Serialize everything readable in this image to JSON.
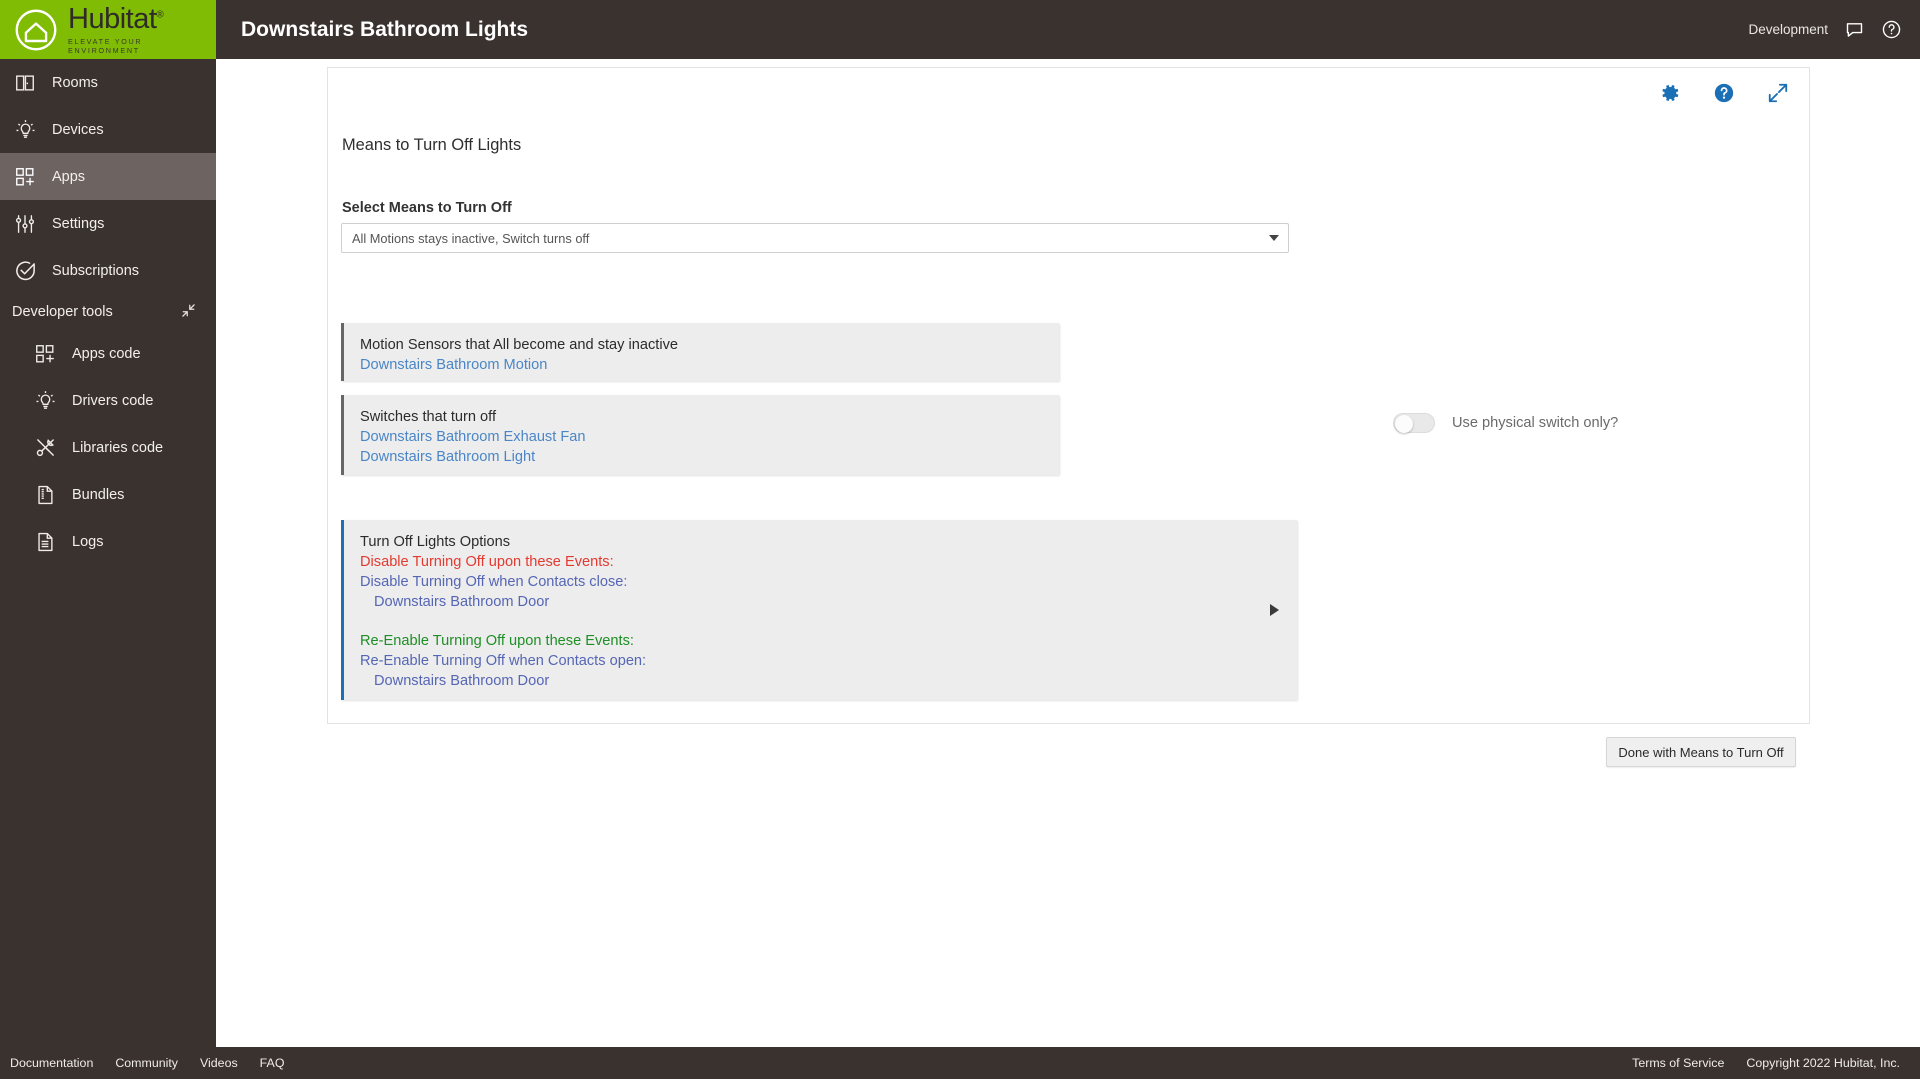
{
  "header": {
    "brand_word": "Hubitat",
    "brand_tagline": "ELEVATE YOUR ENVIRONMENT",
    "page_title": "Downstairs Bathroom Lights",
    "mode_label": "Development",
    "chat_icon": "chat-bubble-icon",
    "help_icon": "help-circle-icon"
  },
  "sidebar": {
    "items": [
      {
        "label": "Rooms",
        "icon": "rooms-icon",
        "active": false
      },
      {
        "label": "Devices",
        "icon": "device-bulb-icon",
        "active": false
      },
      {
        "label": "Apps",
        "icon": "apps-grid-icon",
        "active": true
      },
      {
        "label": "Settings",
        "icon": "sliders-icon",
        "active": false
      },
      {
        "label": "Subscriptions",
        "icon": "check-circle-icon",
        "active": false
      }
    ],
    "section_label": "Developer tools",
    "collapse_icon": "collapse-arrows-icon",
    "dev_items": [
      {
        "label": "Apps code",
        "icon": "apps-grid-icon"
      },
      {
        "label": "Drivers code",
        "icon": "device-bulb-icon"
      },
      {
        "label": "Libraries code",
        "icon": "tools-icon"
      },
      {
        "label": "Bundles",
        "icon": "bundle-file-icon"
      },
      {
        "label": "Logs",
        "icon": "document-lines-icon"
      }
    ]
  },
  "card": {
    "icons": [
      {
        "name": "gear-icon"
      },
      {
        "name": "help-circle-icon"
      },
      {
        "name": "expand-arrows-icon"
      }
    ],
    "section_title": "Means to Turn Off Lights",
    "field_label": "Select Means to Turn Off",
    "select_value": "All Motions stays inactive, Switch turns off",
    "caret_icon": "chevron-down-icon",
    "motion_panel": {
      "heading": "Motion Sensors that All become and stay inactive",
      "devices": [
        "Downstairs Bathroom Motion"
      ]
    },
    "switch_panel": {
      "heading": "Switches that turn off",
      "devices": [
        "Downstairs Bathroom Exhaust Fan",
        "Downstairs Bathroom Light"
      ]
    },
    "toggle": {
      "label": "Use physical switch only?",
      "state": "off"
    },
    "options_panel": {
      "heading": "Turn Off Lights Options",
      "disable_events_title": "Disable Turning Off upon these Events:",
      "disable_contacts_line": "Disable Turning Off when Contacts close:",
      "disable_contacts_device": "Downstairs Bathroom Door",
      "reenable_events_title": "Re-Enable Turning Off upon these Events:",
      "reenable_contacts_line": "Re-Enable Turning Off when Contacts open:",
      "reenable_contacts_device": "Downstairs Bathroom Door",
      "expand_icon": "triangle-right-icon"
    },
    "done_button": "Done with Means to Turn Off",
    "annotation_icon": "orange-down-arrow-icon"
  },
  "footer": {
    "links": [
      "Documentation",
      "Community",
      "Videos",
      "FAQ"
    ],
    "terms": "Terms of Service",
    "copyright": "Copyright 2022 Hubitat, Inc."
  },
  "colors": {
    "brand_green": "#7fbc03",
    "sidebar_dark": "#3a322f",
    "link_blue": "#4a86c7",
    "accent_blue": "#1e6fba",
    "warn_red": "#e33a30",
    "ok_green": "#1d8f25",
    "annotation_orange": "#ef9244"
  }
}
